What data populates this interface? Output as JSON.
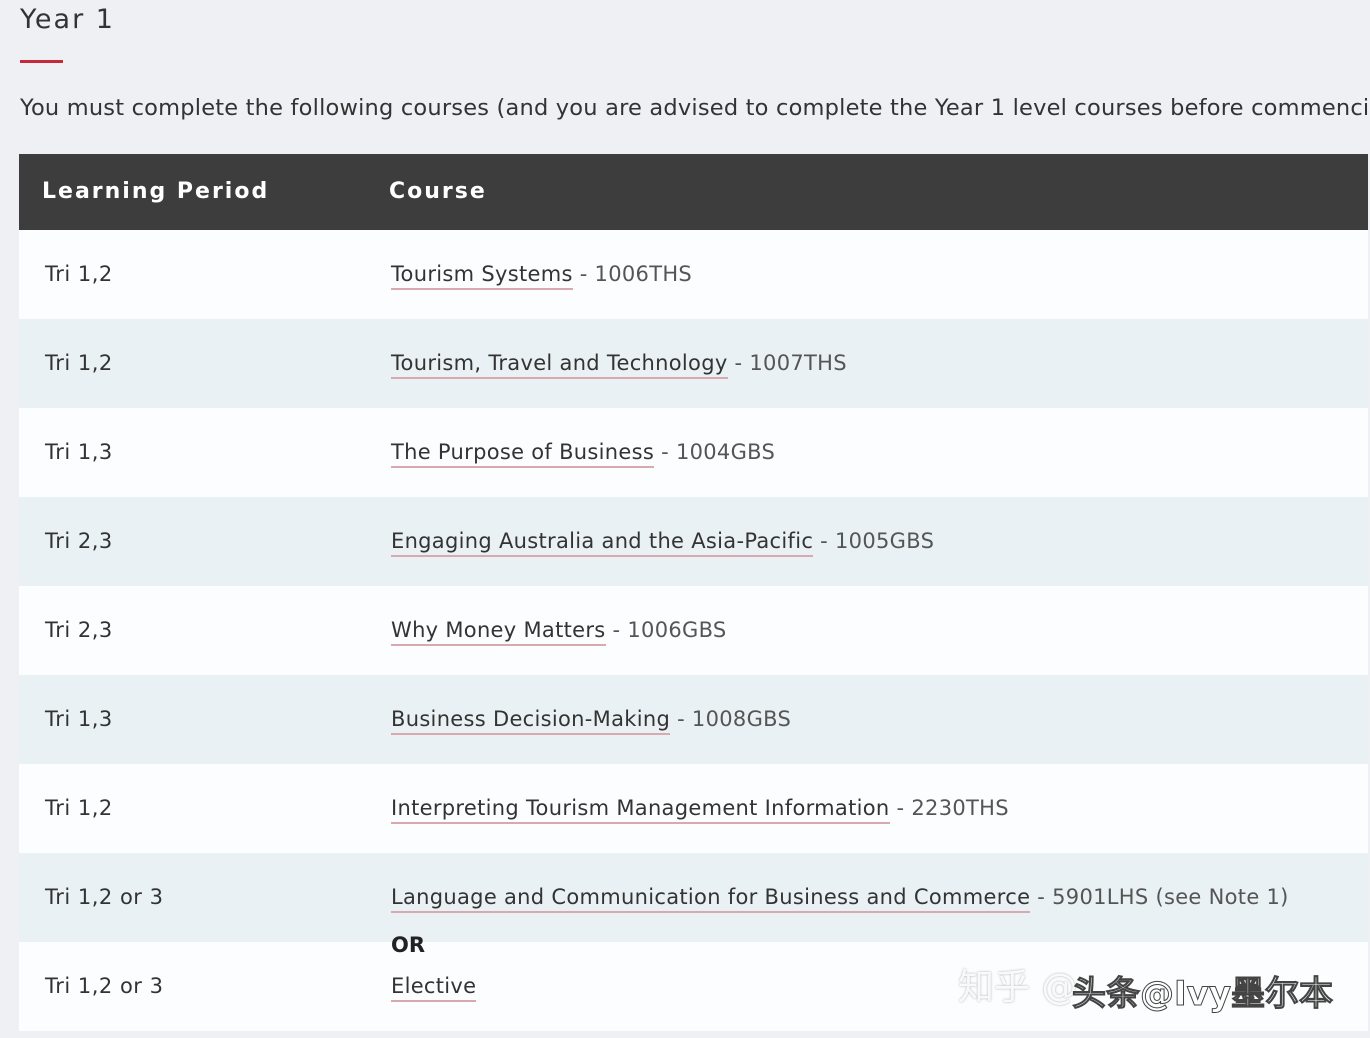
{
  "heading": "Year 1",
  "intro": "You must complete the following courses (and you are advised to complete the Year 1 level courses before commencing",
  "table": {
    "headers": {
      "period": "Learning Period",
      "course": "Course"
    },
    "rows": [
      {
        "period": "Tri 1,2",
        "course": "Tourism Systems",
        "code": "- 1006THS"
      },
      {
        "period": "Tri 1,2",
        "course": "Tourism, Travel and Technology",
        "code": "- 1007THS"
      },
      {
        "period": "Tri 1,3",
        "course": "The Purpose of Business",
        "code": "- 1004GBS"
      },
      {
        "period": "Tri 2,3",
        "course": "Engaging Australia and the Asia-Pacific",
        "code": "- 1005GBS"
      },
      {
        "period": "Tri 2,3",
        "course": "Why Money Matters",
        "code": "- 1006GBS"
      },
      {
        "period": "Tri 1,3",
        "course": "Business Decision-Making",
        "code": "- 1008GBS"
      },
      {
        "period": "Tri 1,2",
        "course": "Interpreting Tourism Management Information",
        "code": "- 2230THS"
      },
      {
        "period": "Tri 1,2 or 3",
        "course": "Language and Communication for Business and Commerce",
        "code": "- 5901LHS (see Note 1)"
      },
      {
        "period": "Tri 1,2 or 3",
        "course": "Elective",
        "code": ""
      }
    ],
    "or_label": "OR"
  },
  "watermark": {
    "zhihu": "知乎 @",
    "toutiao": "头条@Ivy墨尔本"
  }
}
